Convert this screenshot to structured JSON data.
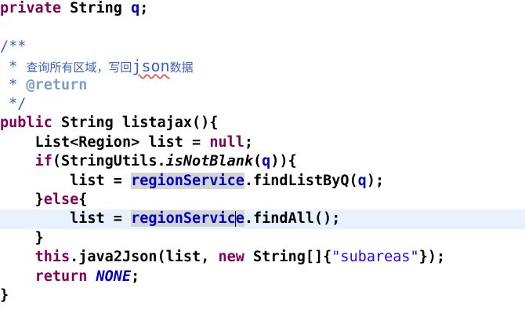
{
  "code": {
    "l1": {
      "kw": "private",
      "type": " String ",
      "field": "q",
      "end": ";"
    },
    "l3": {
      "open": "/**"
    },
    "l4": {
      "star": " * ",
      "cn_before": "查询所有区域，写回",
      "json": "json",
      "cn_after": "数据"
    },
    "l5": {
      "star": " * ",
      "tag": "@return"
    },
    "l6": {
      "close": " */"
    },
    "l7": {
      "kw": "public",
      "rest": " String listajax(){"
    },
    "l8": {
      "indent": "    ",
      "text": "List<Region> list = ",
      "kw": "null",
      "end": ";"
    },
    "l9": {
      "indent": "    ",
      "kw": "if",
      "open": "(StringUtils.",
      "method": "isNotBlank",
      "args": "(",
      "field": "q",
      "close": ")){"
    },
    "l10": {
      "indent": "        ",
      "lhs": "list = ",
      "svc": "regionService",
      "call": ".findListByQ(",
      "field": "q",
      "end": ");"
    },
    "l11": {
      "indent": "    ",
      "brace": "}",
      "kw": "else",
      "open": "{"
    },
    "l12": {
      "indent": "        ",
      "lhs": "list = ",
      "svc_a": "regionServic",
      "svc_b": "e",
      "call": ".findAll();"
    },
    "l13": {
      "indent": "    ",
      "brace": "}"
    },
    "l14": {
      "indent": "    ",
      "kw1": "this",
      "mid": ".java2Json(list, ",
      "kw2": "new",
      "arr": " String[]{",
      "str": "\"subareas\"",
      "end": "});"
    },
    "l15": {
      "indent": "    ",
      "kw": "return",
      "sp": " ",
      "field": "NONE",
      "end": ";"
    },
    "l16": {
      "brace": "}"
    }
  },
  "colors": {
    "keyword": "#7f0055",
    "field": "#0000c0",
    "string": "#2a00ff",
    "javadoc": "#3f5fbf",
    "javadoc_tag": "#7f9fbf",
    "current_line": "#e8f2fe",
    "occurrence_highlight": "#d4d4d4"
  }
}
